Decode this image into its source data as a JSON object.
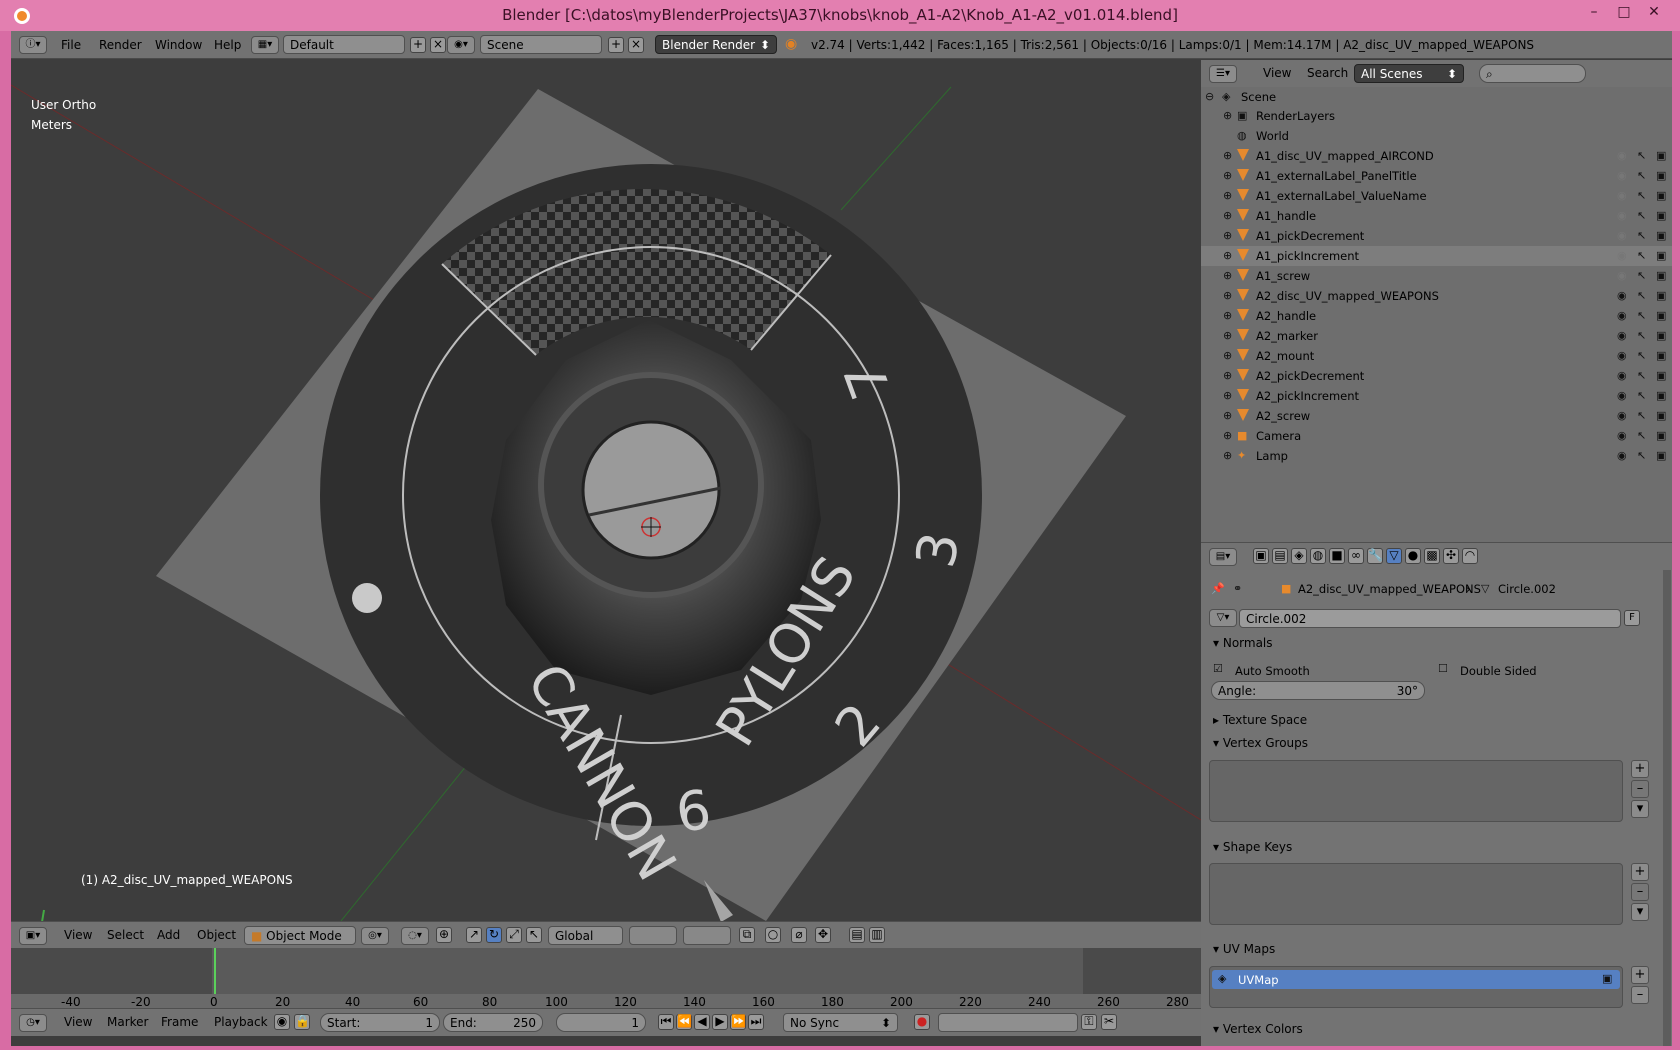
{
  "window": {
    "title": "Blender [C:\\datos\\myBlenderProjects\\JA37\\knobs\\knob_A1-A2\\Knob_A1-A2_v01.014.blend]",
    "minimize": "–",
    "maximize": "□",
    "close": "✕"
  },
  "topbar": {
    "menus": [
      "File",
      "Render",
      "Window",
      "Help"
    ],
    "layout": "Default",
    "scene": "Scene",
    "engine": "Blender Render",
    "stats": "v2.74 | Verts:1,442 | Faces:1,165 | Tris:2,561 | Objects:0/16 | Lamps:0/1 | Mem:14.17M | A2_disc_UV_mapped_WEAPONS"
  },
  "viewport": {
    "view_name": "User Ortho",
    "units": "Meters",
    "active_object": "(1) A2_disc_UV_mapped_WEAPONS",
    "dial_labels": {
      "cannon": "CANNON",
      "pylons": "PYLONS",
      "n2": "2",
      "n3": "3",
      "n7": "7",
      "n6": "6"
    }
  },
  "view3d_header": {
    "menus": [
      "View",
      "Select",
      "Add",
      "Object"
    ],
    "mode": "Object Mode",
    "orientation": "Global"
  },
  "timeline": {
    "ticks": [
      "-40",
      "-20",
      "0",
      "20",
      "40",
      "60",
      "80",
      "100",
      "120",
      "140",
      "160",
      "180",
      "200",
      "220",
      "240",
      "260",
      "280"
    ],
    "menus": [
      "View",
      "Marker",
      "Frame",
      "Playback"
    ],
    "start_label": "Start:",
    "start": "1",
    "end_label": "End:",
    "end": "250",
    "current": "1",
    "sync": "No Sync"
  },
  "outliner": {
    "menus": [
      "View",
      "Search"
    ],
    "filter": "All Scenes",
    "items": [
      {
        "name": "Scene",
        "type": "scene"
      },
      {
        "name": "RenderLayers",
        "type": "renderlayers"
      },
      {
        "name": "World",
        "type": "world"
      },
      {
        "name": "A1_disc_UV_mapped_AIRCOND",
        "type": "mesh"
      },
      {
        "name": "A1_externalLabel_PanelTitle",
        "type": "mesh"
      },
      {
        "name": "A1_externalLabel_ValueName",
        "type": "mesh"
      },
      {
        "name": "A1_handle",
        "type": "mesh"
      },
      {
        "name": "A1_pickDecrement",
        "type": "mesh"
      },
      {
        "name": "A1_pickIncrement",
        "type": "mesh"
      },
      {
        "name": "A1_screw",
        "type": "mesh"
      },
      {
        "name": "A2_disc_UV_mapped_WEAPONS",
        "type": "mesh"
      },
      {
        "name": "A2_handle",
        "type": "mesh"
      },
      {
        "name": "A2_marker",
        "type": "mesh"
      },
      {
        "name": "A2_mount",
        "type": "mesh"
      },
      {
        "name": "A2_pickDecrement",
        "type": "mesh"
      },
      {
        "name": "A2_pickIncrement",
        "type": "mesh"
      },
      {
        "name": "A2_screw",
        "type": "mesh"
      },
      {
        "name": "Camera",
        "type": "camera"
      },
      {
        "name": "Lamp",
        "type": "lamp"
      }
    ]
  },
  "properties": {
    "breadcrumb_object": "A2_disc_UV_mapped_WEAPONS",
    "breadcrumb_data": "Circle.002",
    "datablock": "Circle.002",
    "datablock_f": "F",
    "normals": {
      "title": "Normals",
      "auto_smooth": "Auto Smooth",
      "double_sided": "Double Sided",
      "angle_label": "Angle:",
      "angle": "30°"
    },
    "texture_space": "Texture Space",
    "vertex_groups": "Vertex Groups",
    "shape_keys": "Shape Keys",
    "uv_maps": "UV Maps",
    "uv_map_name": "UVMap",
    "vertex_colors": "Vertex Colors"
  },
  "colors": {
    "accent": "#5680c2",
    "title_pink": "#e37fb0",
    "mesh_orange": "#e78a2d"
  }
}
